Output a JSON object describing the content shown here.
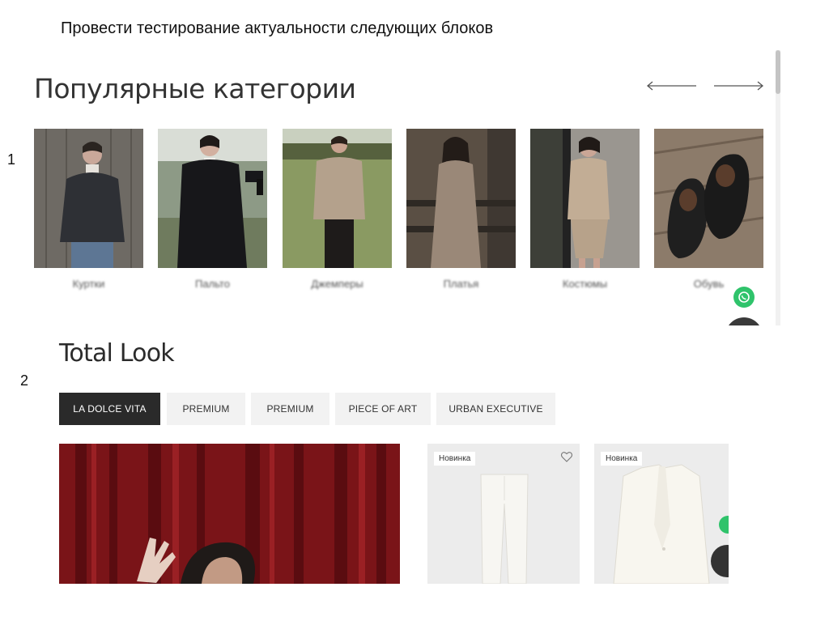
{
  "slide": {
    "title": "Провести тестирование актуальности следующих блоков",
    "markers": [
      "1",
      "2"
    ]
  },
  "popular_categories": {
    "title": "Популярные категории",
    "arrows": {
      "prev": "arrow-left-icon",
      "next": "arrow-right-icon"
    },
    "categories": [
      {
        "label": "Куртки"
      },
      {
        "label": "Пальто"
      },
      {
        "label": "Джемперы"
      },
      {
        "label": "Платья"
      },
      {
        "label": "Костюмы"
      },
      {
        "label": "Обувь"
      }
    ]
  },
  "total_look": {
    "title": "Total Look",
    "tabs": [
      {
        "label": "LA DOLCE VITA",
        "active": true
      },
      {
        "label": "PREMIUM",
        "active": false
      },
      {
        "label": "PREMIUM",
        "active": false
      },
      {
        "label": "PIECE OF ART",
        "active": false
      },
      {
        "label": "URBAN EXECUTIVE",
        "active": false
      }
    ],
    "products": [
      {
        "badge": "Новинка",
        "icon": "heart-icon"
      },
      {
        "badge": "Новинка"
      }
    ]
  },
  "colors": {
    "whatsapp": "#2fc36b",
    "active_tab": "#2a2a2a",
    "curtain": "#7a1418"
  }
}
